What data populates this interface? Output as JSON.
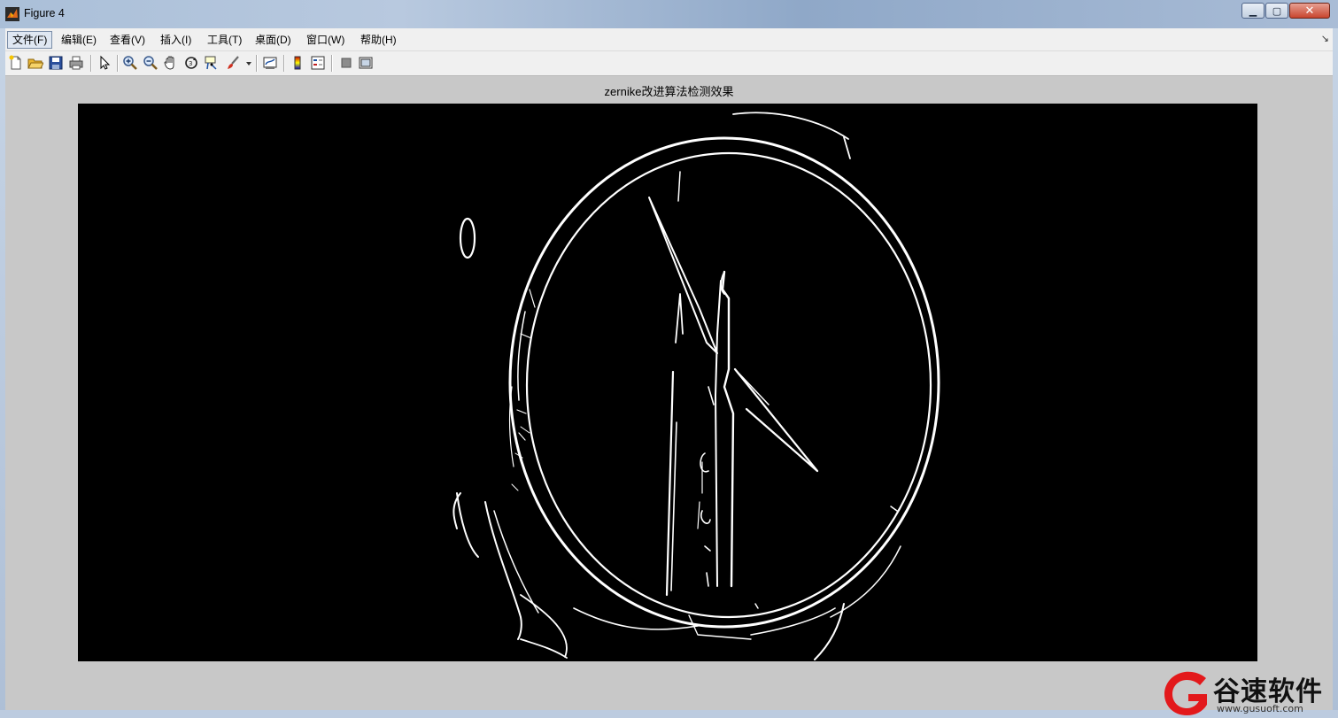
{
  "window": {
    "title": "Figure 4",
    "minimize_glyph": "▁",
    "maximize_glyph": "▢",
    "close_glyph": "✕"
  },
  "menubar": {
    "items": [
      {
        "label": "文件(F)"
      },
      {
        "label": "编辑(E)"
      },
      {
        "label": "查看(V)"
      },
      {
        "label": "插入(I)"
      },
      {
        "label": "工具(T)"
      },
      {
        "label": "桌面(D)"
      },
      {
        "label": "窗口(W)"
      },
      {
        "label": "帮助(H)"
      }
    ],
    "overflow_arrow": "↘"
  },
  "toolbar": {
    "icons": [
      "new-figure-icon",
      "open-file-icon",
      "save-icon",
      "print-icon",
      "pointer-icon",
      "zoom-in-icon",
      "zoom-out-icon",
      "pan-hand-icon",
      "rotate-3d-icon",
      "data-cursor-icon",
      "brush-icon",
      "brush-dropdown-icon",
      "link-plot-icon",
      "insert-colorbar-icon",
      "insert-legend-icon",
      "hide-plot-tools-icon",
      "show-plot-tools-icon"
    ]
  },
  "figure": {
    "axes_title": "zernike改进算法检测效果"
  },
  "watermark": {
    "name": "谷速软件",
    "url": "www.gusuoft.com"
  },
  "colors": {
    "figure_background": "#c8c8c8",
    "image_background": "#000000",
    "edge_color": "#ffffff",
    "titlebar": "#b8c9df"
  }
}
